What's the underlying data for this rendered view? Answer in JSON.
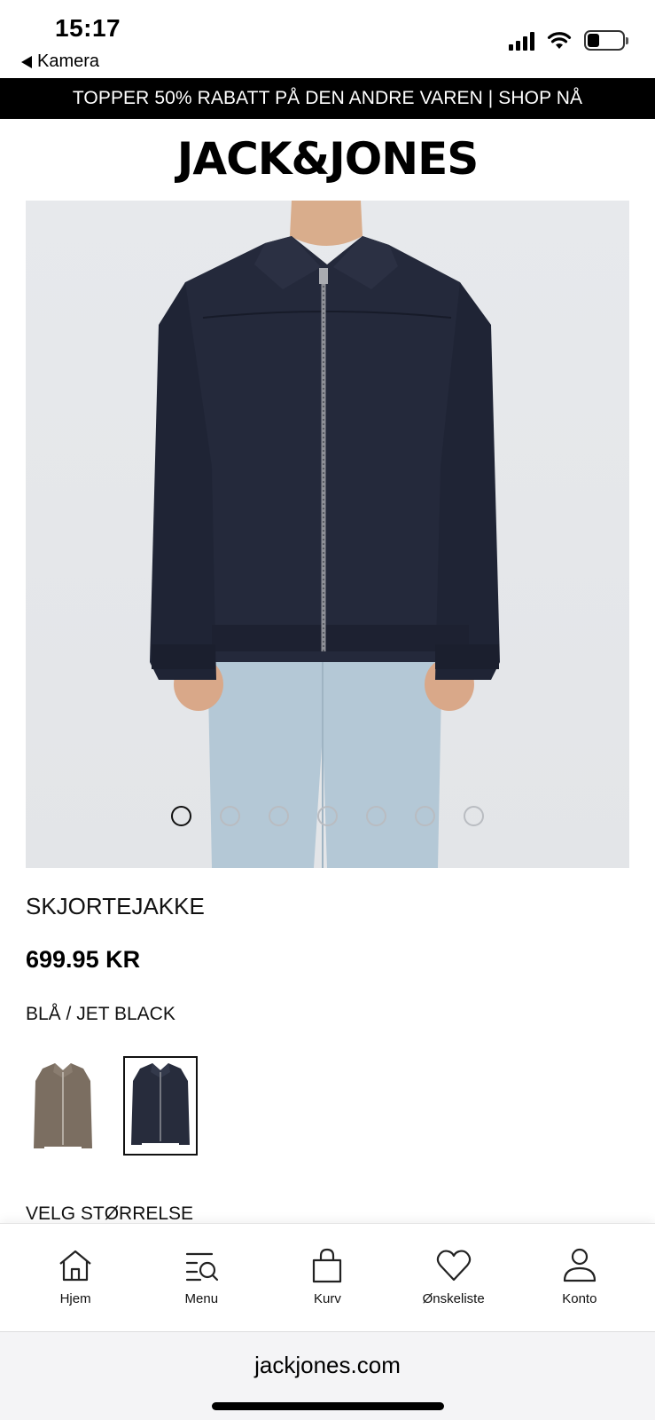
{
  "status_bar": {
    "time": "15:17",
    "back_app": "Kamera",
    "battery_level": 0.35
  },
  "promo": {
    "text": "TOPPER 50% RABATT PÅ DEN ANDRE VAREN | SHOP NÅ"
  },
  "brand": {
    "logo": "JACK&JONES"
  },
  "gallery": {
    "image_count": 7,
    "active_index": 0,
    "colors": {
      "jacket": "#23283a",
      "trousers": "#b4c8d6",
      "background": "#e5e7ea"
    }
  },
  "product": {
    "name": "SKJORTEJAKKE",
    "price": "699.95 KR",
    "color": "BLÅ / JET BLACK",
    "swatches": [
      {
        "name": "brown-variant",
        "color": "#7b6e61",
        "selected": false
      },
      {
        "name": "navy-variant",
        "color": "#272c3c",
        "selected": true
      }
    ]
  },
  "size": {
    "title": "VELG STØRRELSE"
  },
  "bottom_nav": {
    "items": [
      {
        "label": "Hjem",
        "icon": "home-icon"
      },
      {
        "label": "Menu",
        "icon": "menu-search-icon"
      },
      {
        "label": "Kurv",
        "icon": "bag-icon"
      },
      {
        "label": "Ønskeliste",
        "icon": "heart-icon"
      },
      {
        "label": "Konto",
        "icon": "user-icon"
      }
    ]
  },
  "browser": {
    "url": "jackjones.com"
  }
}
